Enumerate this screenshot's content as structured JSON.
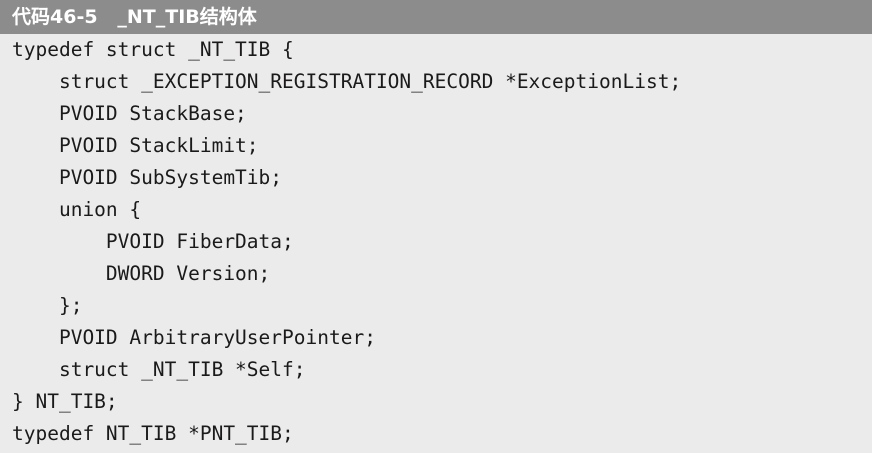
{
  "listing": {
    "caption": "代码46-5   _NT_TIB结构体",
    "code_lines": [
      "typedef struct _NT_TIB {",
      "    struct _EXCEPTION_REGISTRATION_RECORD *ExceptionList;",
      "    PVOID StackBase;",
      "    PVOID StackLimit;",
      "    PVOID SubSystemTib;",
      "    union {",
      "        PVOID FiberData;",
      "        DWORD Version;",
      "    };",
      "    PVOID ArbitraryUserPointer;",
      "    struct _NT_TIB *Self;",
      "} NT_TIB;",
      "typedef NT_TIB *PNT_TIB;"
    ]
  }
}
